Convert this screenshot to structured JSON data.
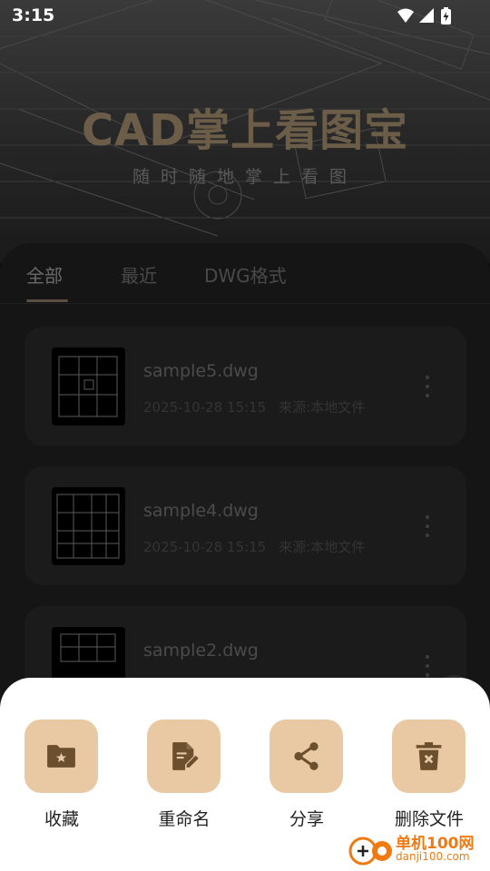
{
  "status_bar": {
    "time": "3:15",
    "icons": [
      "wifi-icon",
      "signal-icon",
      "battery-charging-icon"
    ]
  },
  "hero": {
    "title": "CAD掌上看图宝",
    "subtitle": "随时随地掌上看图"
  },
  "tabs": [
    {
      "label": "全部",
      "active": true
    },
    {
      "label": "最近",
      "active": false
    },
    {
      "label": "DWG格式",
      "active": false
    }
  ],
  "files": [
    {
      "name": "sample5.dwg",
      "time": "2025-10-28 15:15",
      "source": "来源:本地文件"
    },
    {
      "name": "sample4.dwg",
      "time": "2025-10-28 15:15",
      "source": "来源:本地文件"
    },
    {
      "name": "sample2.dwg"
    }
  ],
  "action_sheet": {
    "actions": [
      {
        "label": "收藏",
        "icon": "folder-star-icon"
      },
      {
        "label": "重命名",
        "icon": "edit-document-icon"
      },
      {
        "label": "分享",
        "icon": "share-icon"
      },
      {
        "label": "删除文件",
        "icon": "delete-icon"
      }
    ]
  },
  "watermark": {
    "name": "单机100网",
    "url": "danji100.com"
  },
  "colors": {
    "accent": "#e8c9a3",
    "icon": "#6b4f2e",
    "watermark": "#f07a12"
  }
}
